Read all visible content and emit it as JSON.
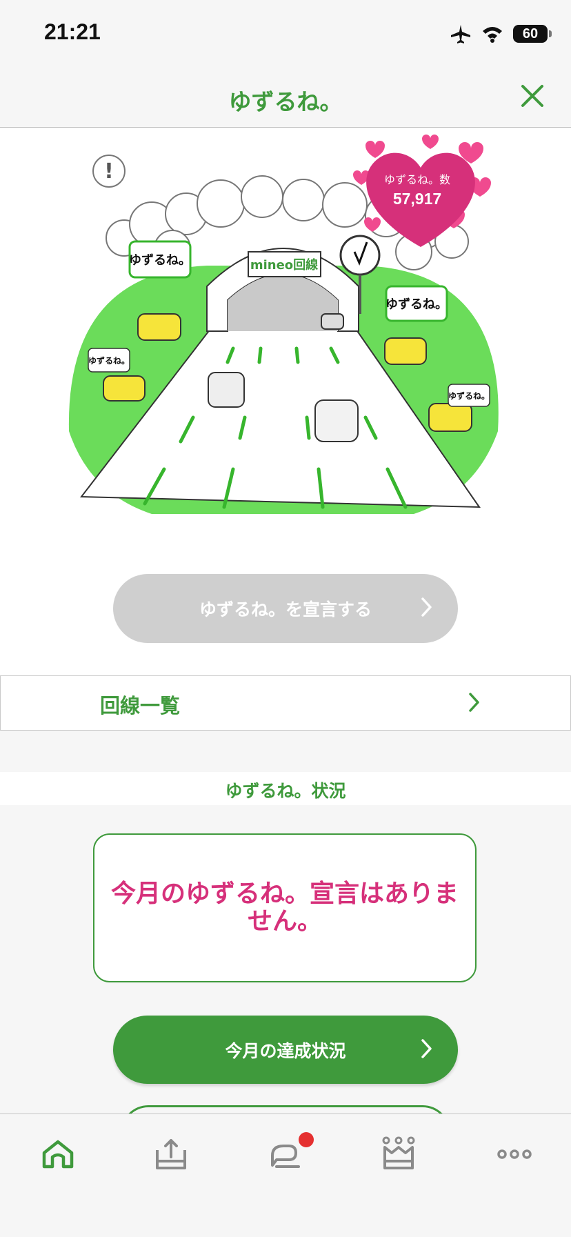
{
  "status_bar": {
    "time": "21:21",
    "battery": "60"
  },
  "header": {
    "title": "ゆずるね。"
  },
  "hero": {
    "counter_label": "ゆずるね。数",
    "counter_value": "57,917",
    "declare_button": "ゆずるね。を宣言する"
  },
  "line_list": {
    "label": "回線一覧"
  },
  "status_section": {
    "title": "ゆずるね。状況",
    "message": "今月のゆずるね。宣言はありません。",
    "progress_button": "今月の達成状況"
  },
  "tab_bar": {
    "tabs": [
      {
        "icon": "home-icon",
        "active": true
      },
      {
        "icon": "upload-tray-icon",
        "active": false
      },
      {
        "icon": "chat-icon",
        "active": false,
        "badge": true
      },
      {
        "icon": "crown-icon",
        "active": false
      },
      {
        "icon": "more-icon",
        "active": false
      }
    ]
  },
  "colors": {
    "brand_green": "#3f9a3c",
    "accent_pink": "#d6307a",
    "disabled_gray": "#cfcfcf",
    "badge_red": "#e53030"
  }
}
